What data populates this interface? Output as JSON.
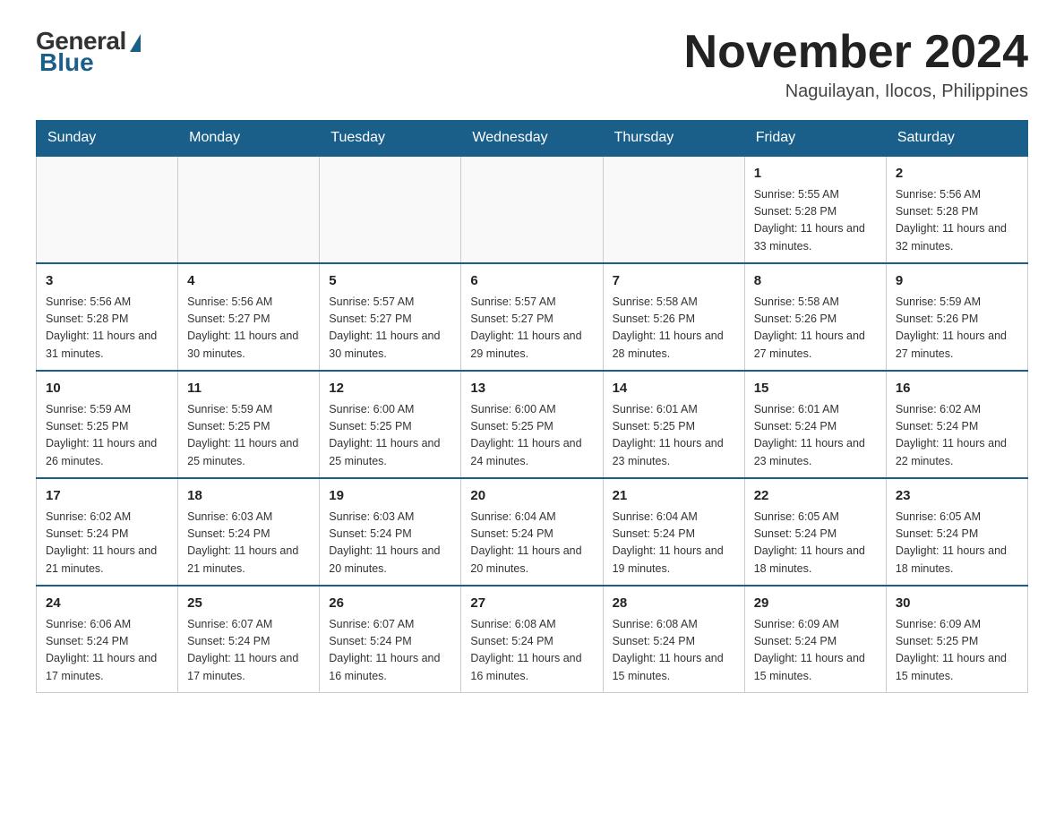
{
  "header": {
    "logo": {
      "general": "General",
      "blue": "Blue"
    },
    "title": "November 2024",
    "location": "Naguilayan, Ilocos, Philippines"
  },
  "days_of_week": [
    "Sunday",
    "Monday",
    "Tuesday",
    "Wednesday",
    "Thursday",
    "Friday",
    "Saturday"
  ],
  "weeks": [
    [
      {
        "day": "",
        "info": ""
      },
      {
        "day": "",
        "info": ""
      },
      {
        "day": "",
        "info": ""
      },
      {
        "day": "",
        "info": ""
      },
      {
        "day": "",
        "info": ""
      },
      {
        "day": "1",
        "info": "Sunrise: 5:55 AM\nSunset: 5:28 PM\nDaylight: 11 hours and 33 minutes."
      },
      {
        "day": "2",
        "info": "Sunrise: 5:56 AM\nSunset: 5:28 PM\nDaylight: 11 hours and 32 minutes."
      }
    ],
    [
      {
        "day": "3",
        "info": "Sunrise: 5:56 AM\nSunset: 5:28 PM\nDaylight: 11 hours and 31 minutes."
      },
      {
        "day": "4",
        "info": "Sunrise: 5:56 AM\nSunset: 5:27 PM\nDaylight: 11 hours and 30 minutes."
      },
      {
        "day": "5",
        "info": "Sunrise: 5:57 AM\nSunset: 5:27 PM\nDaylight: 11 hours and 30 minutes."
      },
      {
        "day": "6",
        "info": "Sunrise: 5:57 AM\nSunset: 5:27 PM\nDaylight: 11 hours and 29 minutes."
      },
      {
        "day": "7",
        "info": "Sunrise: 5:58 AM\nSunset: 5:26 PM\nDaylight: 11 hours and 28 minutes."
      },
      {
        "day": "8",
        "info": "Sunrise: 5:58 AM\nSunset: 5:26 PM\nDaylight: 11 hours and 27 minutes."
      },
      {
        "day": "9",
        "info": "Sunrise: 5:59 AM\nSunset: 5:26 PM\nDaylight: 11 hours and 27 minutes."
      }
    ],
    [
      {
        "day": "10",
        "info": "Sunrise: 5:59 AM\nSunset: 5:25 PM\nDaylight: 11 hours and 26 minutes."
      },
      {
        "day": "11",
        "info": "Sunrise: 5:59 AM\nSunset: 5:25 PM\nDaylight: 11 hours and 25 minutes."
      },
      {
        "day": "12",
        "info": "Sunrise: 6:00 AM\nSunset: 5:25 PM\nDaylight: 11 hours and 25 minutes."
      },
      {
        "day": "13",
        "info": "Sunrise: 6:00 AM\nSunset: 5:25 PM\nDaylight: 11 hours and 24 minutes."
      },
      {
        "day": "14",
        "info": "Sunrise: 6:01 AM\nSunset: 5:25 PM\nDaylight: 11 hours and 23 minutes."
      },
      {
        "day": "15",
        "info": "Sunrise: 6:01 AM\nSunset: 5:24 PM\nDaylight: 11 hours and 23 minutes."
      },
      {
        "day": "16",
        "info": "Sunrise: 6:02 AM\nSunset: 5:24 PM\nDaylight: 11 hours and 22 minutes."
      }
    ],
    [
      {
        "day": "17",
        "info": "Sunrise: 6:02 AM\nSunset: 5:24 PM\nDaylight: 11 hours and 21 minutes."
      },
      {
        "day": "18",
        "info": "Sunrise: 6:03 AM\nSunset: 5:24 PM\nDaylight: 11 hours and 21 minutes."
      },
      {
        "day": "19",
        "info": "Sunrise: 6:03 AM\nSunset: 5:24 PM\nDaylight: 11 hours and 20 minutes."
      },
      {
        "day": "20",
        "info": "Sunrise: 6:04 AM\nSunset: 5:24 PM\nDaylight: 11 hours and 20 minutes."
      },
      {
        "day": "21",
        "info": "Sunrise: 6:04 AM\nSunset: 5:24 PM\nDaylight: 11 hours and 19 minutes."
      },
      {
        "day": "22",
        "info": "Sunrise: 6:05 AM\nSunset: 5:24 PM\nDaylight: 11 hours and 18 minutes."
      },
      {
        "day": "23",
        "info": "Sunrise: 6:05 AM\nSunset: 5:24 PM\nDaylight: 11 hours and 18 minutes."
      }
    ],
    [
      {
        "day": "24",
        "info": "Sunrise: 6:06 AM\nSunset: 5:24 PM\nDaylight: 11 hours and 17 minutes."
      },
      {
        "day": "25",
        "info": "Sunrise: 6:07 AM\nSunset: 5:24 PM\nDaylight: 11 hours and 17 minutes."
      },
      {
        "day": "26",
        "info": "Sunrise: 6:07 AM\nSunset: 5:24 PM\nDaylight: 11 hours and 16 minutes."
      },
      {
        "day": "27",
        "info": "Sunrise: 6:08 AM\nSunset: 5:24 PM\nDaylight: 11 hours and 16 minutes."
      },
      {
        "day": "28",
        "info": "Sunrise: 6:08 AM\nSunset: 5:24 PM\nDaylight: 11 hours and 15 minutes."
      },
      {
        "day": "29",
        "info": "Sunrise: 6:09 AM\nSunset: 5:24 PM\nDaylight: 11 hours and 15 minutes."
      },
      {
        "day": "30",
        "info": "Sunrise: 6:09 AM\nSunset: 5:25 PM\nDaylight: 11 hours and 15 minutes."
      }
    ]
  ]
}
